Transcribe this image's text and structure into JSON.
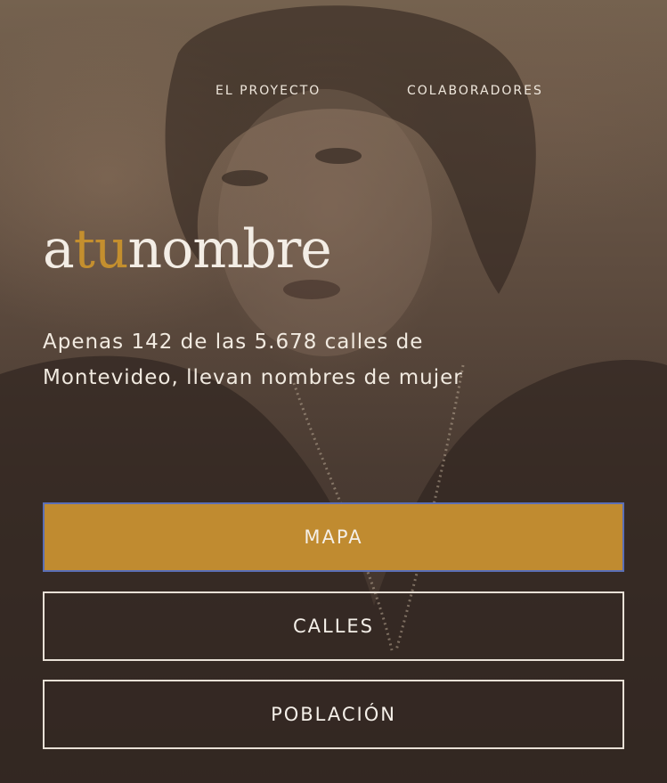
{
  "nav": {
    "items": [
      {
        "label": "EL PROYECTO"
      },
      {
        "label": "COLABORADORES"
      }
    ]
  },
  "brand": {
    "part1": "a",
    "part2": "tu",
    "part3": "nombre",
    "accent_color": "#c48f2e"
  },
  "hero": {
    "line1": "Apenas 142 de las 5.678 calles de",
    "line2": "Montevideo, llevan nombres de mujer"
  },
  "buttons": {
    "mapa": "MAPA",
    "calles": "CALLES",
    "poblacion": "POBLACIÓN"
  },
  "colors": {
    "primary_button": "#c08b30",
    "focus_outline": "#5b6fb6",
    "background": "#5e4c3f"
  }
}
